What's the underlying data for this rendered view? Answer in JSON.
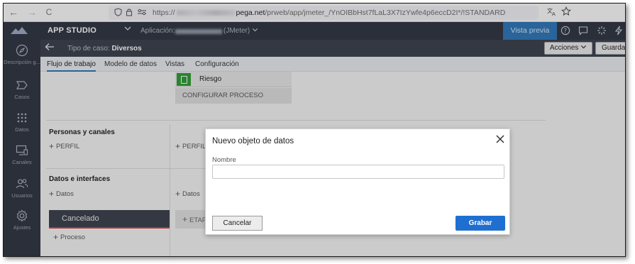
{
  "browser": {
    "back_icon": "←",
    "forward_icon": "→",
    "reload_icon": "C",
    "url_prefix": "https://",
    "url_host": "pega.net",
    "url_path": "/prweb/app/jmeter_/YnOIBbHst7fLaL3X7IzYwfe4p6eccD2I*/!STANDARD"
  },
  "appbar": {
    "title": "APP STUDIO",
    "application_label": "Aplicación:",
    "application_name": "(JMeter)",
    "preview_button": "Vista previa",
    "icons": [
      "help-icon",
      "chat-icon",
      "loading-icon",
      "bolt-icon"
    ]
  },
  "casebar": {
    "label": "Tipo de caso:",
    "case_name": "Diversos",
    "actions_button": "Acciones",
    "save_button": "Guardar"
  },
  "sidebar": {
    "items": [
      {
        "label": "Descripción g...",
        "icon": "compass-icon"
      },
      {
        "label": "Casos",
        "icon": "case-icon"
      },
      {
        "label": "Datos",
        "icon": "grid-icon"
      },
      {
        "label": "Canales",
        "icon": "monitor-icon"
      },
      {
        "label": "Usuarios",
        "icon": "users-icon"
      },
      {
        "label": "Ajustes",
        "icon": "gear-icon"
      }
    ]
  },
  "tabs": [
    {
      "label": "Flujo de trabajo",
      "active": true
    },
    {
      "label": "Modelo de datos",
      "active": false
    },
    {
      "label": "Vistas",
      "active": false
    },
    {
      "label": "Configuración",
      "active": false
    }
  ],
  "canvas": {
    "stage_step": "Riesgo",
    "configure_process": "CONFIGURAR PROCESO",
    "section_personas": "Personas y canales",
    "add_perfil": "PERFIL",
    "section_datos": "Datos e interfaces",
    "add_datos": "Datos",
    "cancel_stage": "Cancelado",
    "add_proceso": "Proceso",
    "add_etapa": "ETAPA"
  },
  "modal": {
    "title": "Nuevo objeto de datos",
    "field_label": "Nombre",
    "field_value": "",
    "field_placeholder": "",
    "cancel_button": "Cancelar",
    "save_button": "Grabar"
  },
  "colors": {
    "app_dark": "#2f3441",
    "accent_blue": "#1f6fd1",
    "stage_green": "#2e9a35",
    "cancel_red": "#d23b3b"
  }
}
